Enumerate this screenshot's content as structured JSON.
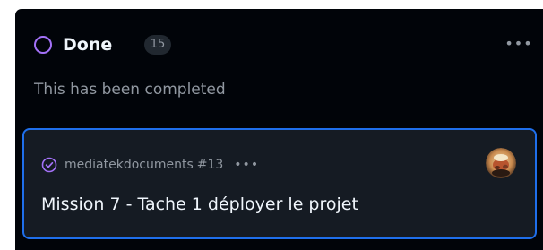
{
  "column": {
    "title": "Done",
    "count": "15",
    "description": "This has been completed",
    "menu_icon": "kebab-horizontal-icon",
    "status_color": "#a371f7"
  },
  "card": {
    "status_icon": "check-circle-icon",
    "repo": "mediatekdocuments",
    "issue_number": "#13",
    "menu_icon": "kebab-horizontal-icon",
    "title": "Mission 7 - Tache 1 déployer le projet",
    "border_color": "#1f6feb"
  }
}
